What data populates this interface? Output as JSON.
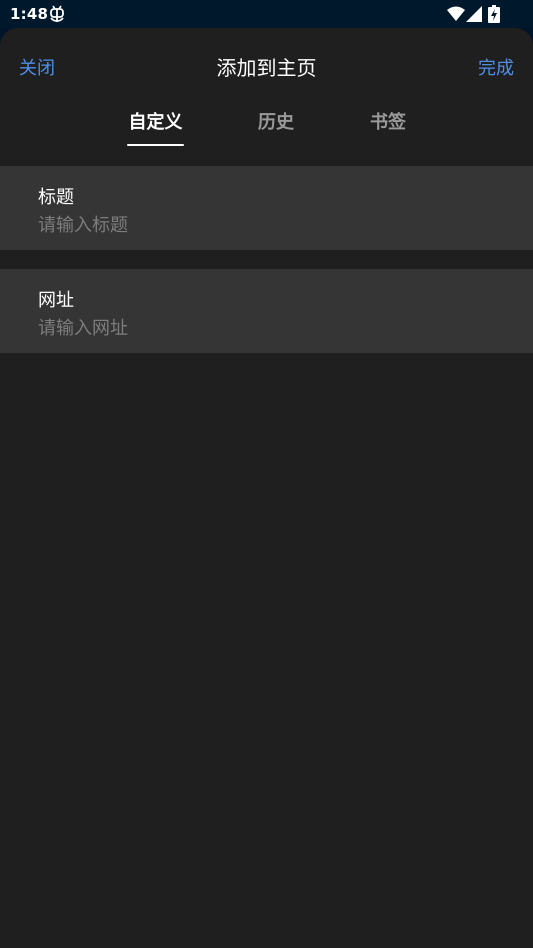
{
  "status_bar": {
    "time": "1:48",
    "icons": [
      "bug-icon",
      "wifi-icon",
      "signal-icon",
      "battery-charging-icon"
    ]
  },
  "header": {
    "close_label": "关闭",
    "title": "添加到主页",
    "done_label": "完成"
  },
  "tabs": [
    {
      "label": "自定义",
      "active": true
    },
    {
      "label": "历史",
      "active": false
    },
    {
      "label": "书签",
      "active": false
    }
  ],
  "form": {
    "title_field": {
      "label": "标题",
      "placeholder": "请输入标题",
      "value": ""
    },
    "url_field": {
      "label": "网址",
      "placeholder": "请输入网址",
      "value": ""
    }
  },
  "colors": {
    "accent": "#4f8fe8",
    "background": "#1f1f1f",
    "field_background": "#353535",
    "status_bar": "#00182c"
  }
}
